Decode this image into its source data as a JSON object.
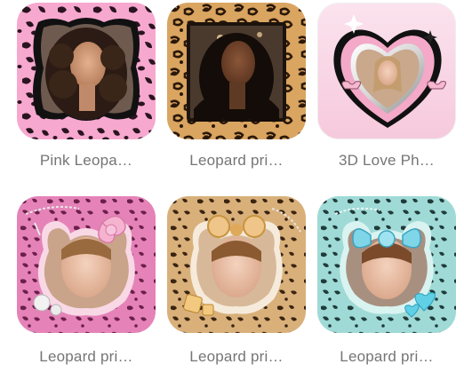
{
  "templates": [
    {
      "label": "Pink Leopa…",
      "thumbnail": "pink-leopard-frame",
      "accent": "#f47ab4"
    },
    {
      "label": "Leopard pri…",
      "thumbnail": "leopard-print-frame",
      "accent": "#c98a3a"
    },
    {
      "label": "3D Love Ph…",
      "thumbnail": "3d-love-heart-frame",
      "accent": "#f6c6d8"
    },
    {
      "label": "Leopard pri…",
      "thumbnail": "pink-leopard-bow-frame",
      "accent": "#e06aa8"
    },
    {
      "label": "Leopard pri…",
      "thumbnail": "brown-leopard-bear-frame",
      "accent": "#c79a62"
    },
    {
      "label": "Leopard pri…",
      "thumbnail": "teal-leopard-bow-frame",
      "accent": "#7fd3cf"
    }
  ]
}
